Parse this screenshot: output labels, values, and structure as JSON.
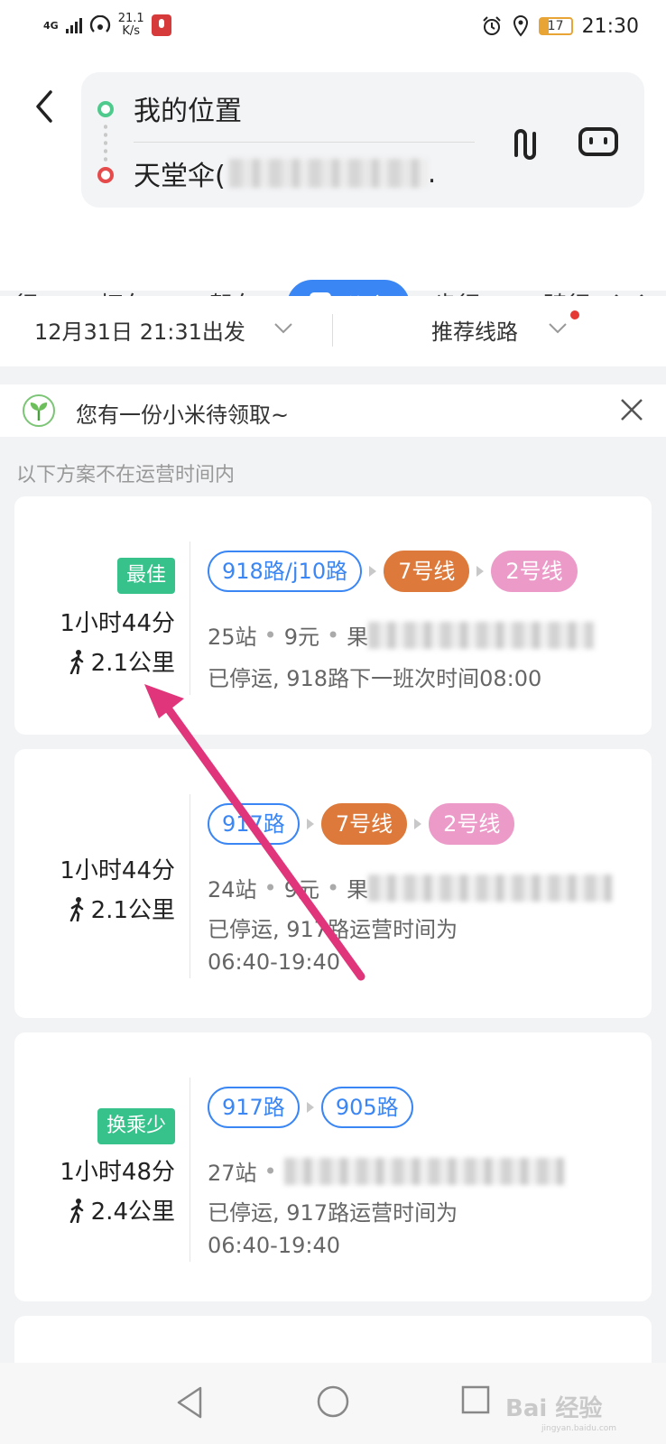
{
  "status_bar": {
    "network": "4G",
    "speed_value": "21.1",
    "speed_unit": "K/s",
    "battery": "17",
    "time": "21:30"
  },
  "route": {
    "start": "我的位置",
    "end_prefix": "天堂伞(",
    "end_suffix": "."
  },
  "tabs": [
    {
      "label": "行"
    },
    {
      "label": "打车"
    },
    {
      "label": "驾车"
    },
    {
      "label": "公交",
      "active": true
    },
    {
      "label": "步行"
    },
    {
      "label": "骑行"
    }
  ],
  "filters": {
    "depart": "12月31日 21:31出发",
    "preference": "推荐线路"
  },
  "promo": {
    "text": "您有一份小米待领取~"
  },
  "notice": "以下方案不在运营时间内",
  "routes": [
    {
      "badge": "最佳",
      "duration": "1小时44分",
      "walk": "2.1公里",
      "lines": [
        "918路/j10路",
        "7号线",
        "2号线"
      ],
      "stops": "25站",
      "fare": "9元",
      "blur_prefix": "果",
      "status_line1": "已停运, 918路下一班次时间08:00",
      "status_line2": ""
    },
    {
      "badge": "",
      "duration": "1小时44分",
      "walk": "2.1公里",
      "lines": [
        "917路",
        "7号线",
        "2号线"
      ],
      "stops": "24站",
      "fare": "9元",
      "blur_prefix": "果",
      "status_line1": "已停运, 917路运营时间为",
      "status_line2": "06:40-19:40"
    },
    {
      "badge": "换乘少",
      "duration": "1小时48分",
      "walk": "2.4公里",
      "lines": [
        "917路",
        "905路"
      ],
      "stops": "27站",
      "fare": "",
      "blur_prefix": "",
      "status_line1": "已停运, 917路运营时间为",
      "status_line2": "06:40-19:40"
    }
  ],
  "watermark": {
    "brand": "Bai 经验",
    "url": "jingyan.baidu.com"
  },
  "colors": {
    "accent": "#3a86f4",
    "badge_green": "#37c28b",
    "metro7": "#dd7a3b",
    "metro2": "#ec9bc9",
    "arrow": "#e0357a"
  }
}
